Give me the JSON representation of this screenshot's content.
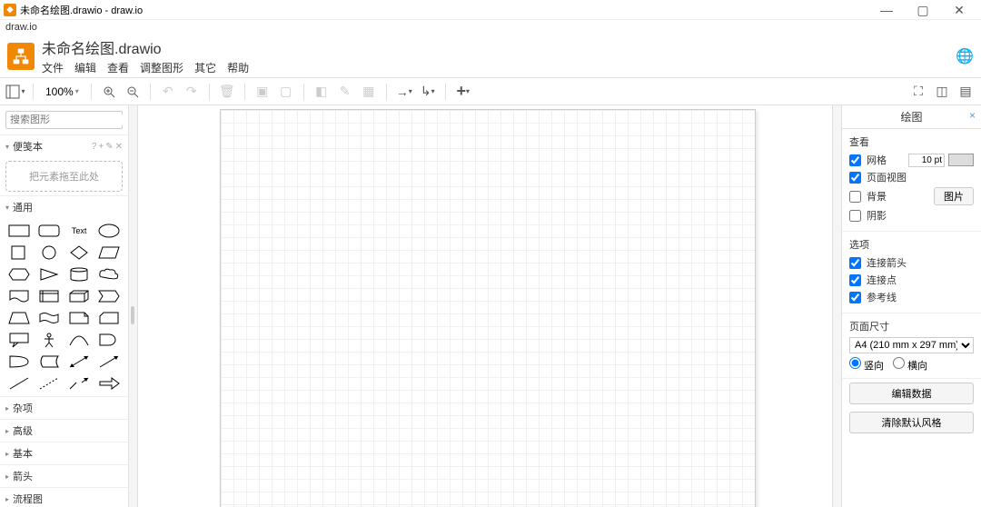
{
  "window": {
    "title": "未命名绘图.drawio - draw.io",
    "appname": "draw.io"
  },
  "header": {
    "doc_title": "未命名绘图.drawio",
    "menu": [
      "文件",
      "编辑",
      "查看",
      "调整图形",
      "其它",
      "帮助"
    ]
  },
  "toolbar": {
    "zoom": "100%"
  },
  "sidebar": {
    "search_placeholder": "搜索图形",
    "scratchpad": {
      "title": "便笺本",
      "hint": "把元素拖至此处"
    },
    "sections": {
      "general": "通用",
      "misc": "杂项",
      "advanced": "高级",
      "basic": "基本",
      "arrows": "箭头",
      "flowchart": "流程图"
    }
  },
  "rightpanel": {
    "title": "绘图",
    "view": {
      "heading": "查看",
      "grid": "网格",
      "grid_value": "10 pt",
      "pageview": "页面视图",
      "background": "背景",
      "bg_button": "图片",
      "shadow": "阴影"
    },
    "options": {
      "heading": "选项",
      "arrows": "连接箭头",
      "points": "连接点",
      "guides": "参考线"
    },
    "pagesize": {
      "heading": "页面尺寸",
      "value": "A4 (210 mm x 297 mm)",
      "portrait": "竖向",
      "landscape": "横向"
    },
    "buttons": {
      "editdata": "编辑数据",
      "clearstyle": "清除默认风格"
    }
  }
}
